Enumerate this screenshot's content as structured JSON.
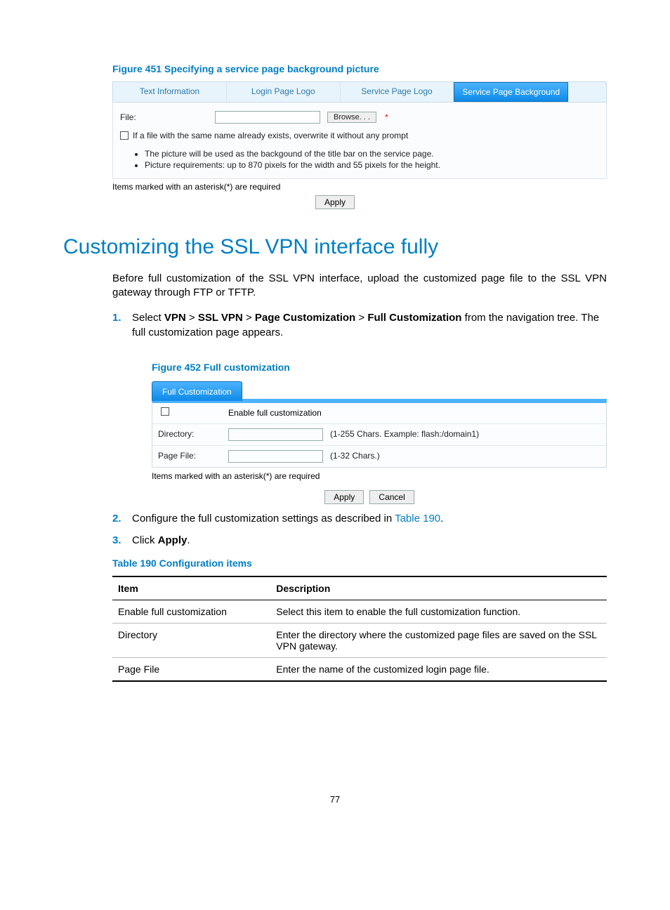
{
  "figure451": {
    "caption": "Figure 451 Specifying a service page background picture",
    "tabs": [
      "Text Information",
      "Login Page Logo",
      "Service Page Logo",
      "Service Page Background"
    ],
    "active_tab_index": 3,
    "file_label": "File:",
    "browse_label": "Browse. . .",
    "overwrite_label": "If a file with the same name already exists, overwrite it without any prompt",
    "notes": [
      "The picture will be used as the backgound of the title bar on the service page.",
      "Picture requirements: up to 870 pixels for the width and 55 pixels for the height."
    ],
    "required_note": "Items marked with an asterisk(*) are required",
    "apply_label": "Apply"
  },
  "section": {
    "heading": "Customizing the SSL VPN interface fully",
    "intro": "Before full customization of the SSL VPN interface, upload the customized page file to the SSL VPN gateway through FTP or TFTP.",
    "step1_pre": "Select ",
    "step1_nav": [
      "VPN",
      "SSL VPN",
      "Page Customization",
      "Full Customization"
    ],
    "step1_post": " from the navigation tree. The full customization page appears.",
    "step2_pre": "Configure the full customization settings as described in ",
    "step2_link": "Table 190",
    "step2_post": ".",
    "step3_pre": "Click ",
    "step3_bold": "Apply",
    "step3_post": "."
  },
  "figure452": {
    "caption": "Figure 452 Full customization",
    "tab_label": "Full Customization",
    "enable_label": "Enable full customization",
    "dir_label": "Directory:",
    "dir_hint": "(1-255 Chars. Example: flash:/domain1)",
    "page_label": "Page File:",
    "page_hint": "(1-32 Chars.)",
    "required_note": "Items marked with an asterisk(*) are required",
    "apply_label": "Apply",
    "cancel_label": "Cancel"
  },
  "table190": {
    "caption": "Table 190 Configuration items",
    "headers": [
      "Item",
      "Description"
    ],
    "rows": [
      [
        "Enable full customization",
        "Select this item to enable the full customization function."
      ],
      [
        "Directory",
        "Enter the directory where the customized page files are saved on the SSL VPN gateway."
      ],
      [
        "Page File",
        "Enter the name of the customized login page file."
      ]
    ]
  },
  "page_number": "77"
}
